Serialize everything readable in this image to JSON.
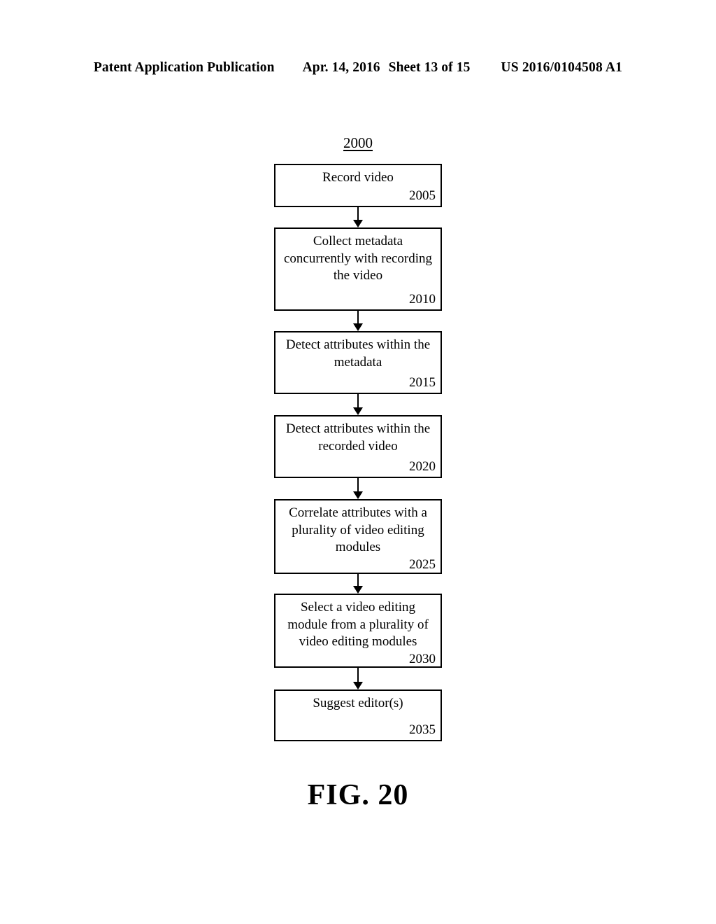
{
  "header": {
    "publication": "Patent Application Publication",
    "date": "Apr. 14, 2016",
    "sheet": "Sheet 13 of 15",
    "document_number": "US 2016/0104508 A1"
  },
  "figure": {
    "reference_number": "2000",
    "caption": "FIG. 20",
    "type": "flowchart",
    "steps": [
      {
        "id": "2005",
        "text": "Record video"
      },
      {
        "id": "2010",
        "text": "Collect metadata concurrently with recording the video"
      },
      {
        "id": "2015",
        "text": "Detect attributes within the metadata"
      },
      {
        "id": "2020",
        "text": "Detect attributes within the recorded video"
      },
      {
        "id": "2025",
        "text": "Correlate attributes with a plurality of video editing modules"
      },
      {
        "id": "2030",
        "text": "Select a video editing module from a plurality of video editing modules"
      },
      {
        "id": "2035",
        "text": "Suggest editor(s)"
      }
    ]
  }
}
